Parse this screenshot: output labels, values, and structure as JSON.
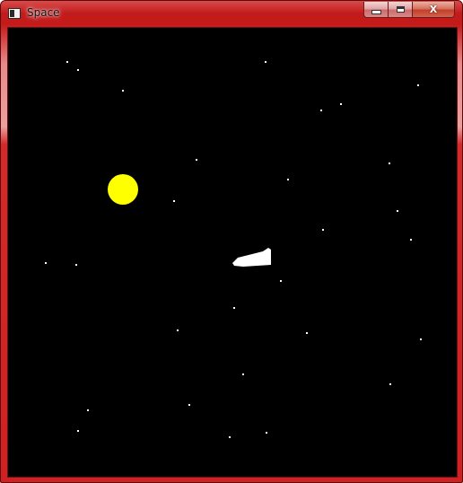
{
  "window": {
    "title": "Space",
    "minimize_label": "",
    "maximize_label": "",
    "close_label": "X"
  },
  "icons": {
    "app": "window-app-icon",
    "minimize": "minimize-icon",
    "maximize": "maximize-icon",
    "close": "close-icon"
  },
  "colors": {
    "frame": "#c81e1e",
    "space_background": "#000000",
    "star": "#ffffff",
    "sun": "#ffff00",
    "ship": "#ffffff"
  }
}
